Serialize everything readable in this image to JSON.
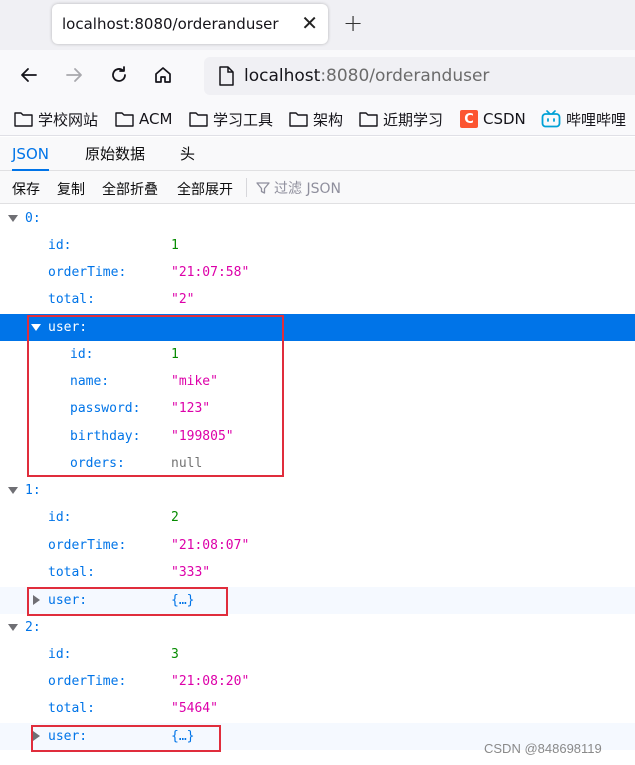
{
  "browser": {
    "tab_title": "localhost:8080/orderanduser",
    "tab_close": "✕",
    "new_tab": "+",
    "url_host": "localhost",
    "url_rest": ":8080/orderanduser"
  },
  "bookmarks": [
    {
      "label": "学校网站",
      "icon": "folder-icon"
    },
    {
      "label": "ACM",
      "icon": "folder-icon"
    },
    {
      "label": "学习工具",
      "icon": "folder-icon"
    },
    {
      "label": "架构",
      "icon": "folder-icon"
    },
    {
      "label": "近期学习",
      "icon": "folder-icon"
    },
    {
      "label": "CSDN",
      "icon": "csdn-icon",
      "icon_text": "C"
    },
    {
      "label": "哔哩哔哩",
      "icon": "bilibili-icon"
    }
  ],
  "viewer_tabs": [
    "JSON",
    "原始数据",
    "头"
  ],
  "toolbar": {
    "save": "保存",
    "copy": "复制",
    "collapse_all": "全部折叠",
    "expand_all": "全部展开",
    "filter_placeholder": "过滤 JSON"
  },
  "tree": [
    {
      "key": "0:",
      "value": "",
      "type": "index"
    },
    {
      "key": "id:",
      "value": "1",
      "type": "num"
    },
    {
      "key": "orderTime:",
      "value": "\"21:07:58\"",
      "type": "str"
    },
    {
      "key": "total:",
      "value": "\"2\"",
      "type": "str"
    },
    {
      "key": "user:",
      "value": "",
      "type": "open"
    },
    {
      "key": "id:",
      "value": "1",
      "type": "num"
    },
    {
      "key": "name:",
      "value": "\"mike\"",
      "type": "str"
    },
    {
      "key": "password:",
      "value": "\"123\"",
      "type": "str"
    },
    {
      "key": "birthday:",
      "value": "\"199805\"",
      "type": "str"
    },
    {
      "key": "orders:",
      "value": "null",
      "type": "nul"
    },
    {
      "key": "1:",
      "value": "",
      "type": "index"
    },
    {
      "key": "id:",
      "value": "2",
      "type": "num"
    },
    {
      "key": "orderTime:",
      "value": "\"21:08:07\"",
      "type": "str"
    },
    {
      "key": "total:",
      "value": "\"333\"",
      "type": "str"
    },
    {
      "key": "user:",
      "value": "{…}",
      "type": "obj"
    },
    {
      "key": "2:",
      "value": "",
      "type": "index"
    },
    {
      "key": "id:",
      "value": "3",
      "type": "num"
    },
    {
      "key": "orderTime:",
      "value": "\"21:08:20\"",
      "type": "str"
    },
    {
      "key": "total:",
      "value": "\"5464\"",
      "type": "str"
    },
    {
      "key": "user:",
      "value": "{…}",
      "type": "obj"
    }
  ],
  "watermark": "CSDN @848698119",
  "colors": {
    "accent": "#0074e8",
    "number": "#058b00",
    "string": "#dd00a9",
    "annotation": "#e02d3c"
  }
}
